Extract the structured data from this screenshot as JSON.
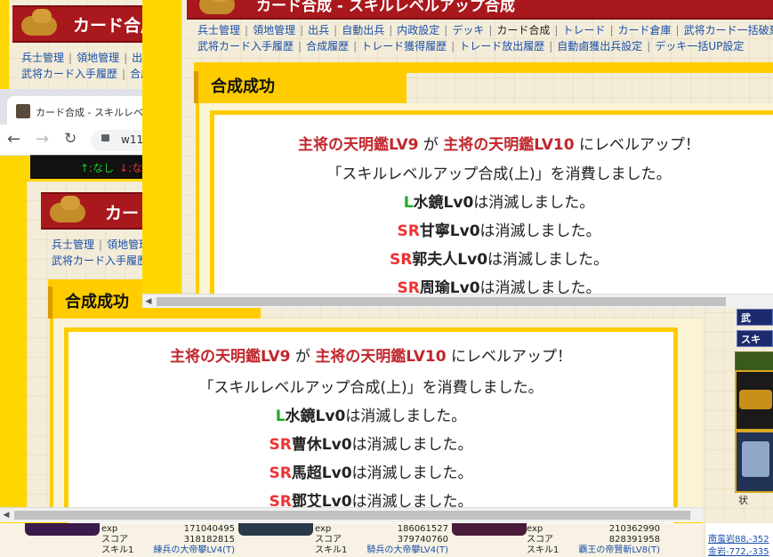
{
  "colors": {
    "brand_red": "#a8181c",
    "gold": "#ffcc00",
    "link_blue": "#1a4fa8",
    "title_red": "#c1272d",
    "rarity_red": "#ee3333",
    "rarity_green": "#22aa22"
  },
  "browser": {
    "tab_title": "カード合成 - スキルレベルア",
    "url_fragment": "w11",
    "status_up": "↑:なし",
    "status_down": "↓:なし"
  },
  "win_back": {
    "bar_title": "カード合成",
    "links_row1": [
      "兵士管理",
      "領地管理",
      "出"
    ],
    "links_row2": [
      "武将カード入手履歴",
      "合成"
    ]
  },
  "win_mid": {
    "bar_title": "カード",
    "links_row1": [
      "兵士管理",
      "領地管理"
    ],
    "links_row2": [
      "武将カード入手履歴"
    ],
    "success_heading": "合成成功",
    "result": {
      "line1_a": "主将の天明鑑LV9",
      "line1_mid": " が ",
      "line1_b": "主将の天明鑑LV10",
      "line1_end": " にレベルアップ！",
      "line2": "「スキルレベルアップ合成(上)」を消費しました。",
      "items": [
        {
          "rarity": "L",
          "name": "水鏡Lv0",
          "suffix": "は消滅しました。"
        },
        {
          "rarity": "SR",
          "name": "曹休Lv0",
          "suffix": "は消滅しました。"
        },
        {
          "rarity": "SR",
          "name": "馬超Lv0",
          "suffix": "は消滅しました。"
        },
        {
          "rarity": "SR",
          "name": "鄧艾Lv0",
          "suffix": "は消滅しました。"
        }
      ]
    }
  },
  "win_front": {
    "bar_title": "カード合成 - スキルレベルアップ合成",
    "links_row1": [
      "兵士管理",
      "領地管理",
      "出兵",
      "自動出兵",
      "内政設定",
      "デッキ",
      "カード合成",
      "トレード",
      "カード倉庫",
      "武将カード一括破棄"
    ],
    "links_row2": [
      "武将カード入手履歴",
      "合成履歴",
      "トレード獲得履歴",
      "トレード放出履歴",
      "自動鹵獲出兵設定",
      "デッキ一括UP設定"
    ],
    "current_link": "カード合成",
    "success_heading": "合成成功",
    "result": {
      "line1_a": "主将の天明鑑LV9",
      "line1_mid": " が ",
      "line1_b": "主将の天明鑑LV10",
      "line1_end": " にレベルアップ！",
      "line2": "「スキルレベルアップ合成(上)」を消費しました。",
      "items": [
        {
          "rarity": "L",
          "name": "水鏡Lv0",
          "suffix": "は消滅しました。"
        },
        {
          "rarity": "SR",
          "name": "甘寧Lv0",
          "suffix": "は消滅しました。"
        },
        {
          "rarity": "SR",
          "name": "郭夫人Lv0",
          "suffix": "は消滅しました。"
        },
        {
          "rarity": "SR",
          "name": "周瑜Lv0",
          "suffix": "は消滅しました。"
        }
      ]
    }
  },
  "bottom_cards": [
    {
      "exp_label": "exp",
      "exp": "171040495",
      "score_label": "スコア",
      "score": "318182815",
      "skill_label": "スキル1",
      "skill": "練兵の大帝攀LV4",
      "tag": "(T)"
    },
    {
      "exp_label": "exp",
      "exp": "186061527",
      "score_label": "スコア",
      "score": "379740760",
      "skill_label": "スキル1",
      "skill": "騎兵の大帝攀LV4",
      "tag": "(T)"
    },
    {
      "exp_label": "exp",
      "exp": "210362990",
      "score_label": "スコア",
      "score": "828391958",
      "skill_label": "スキル1",
      "skill": "覇王の帝賢斬LV8",
      "tag": "(T)"
    }
  ],
  "side_links": [
    "南蛮岩88,-352",
    "金岩-772,-335"
  ],
  "side_buttons": [
    "武",
    "スキ",
    "状"
  ]
}
